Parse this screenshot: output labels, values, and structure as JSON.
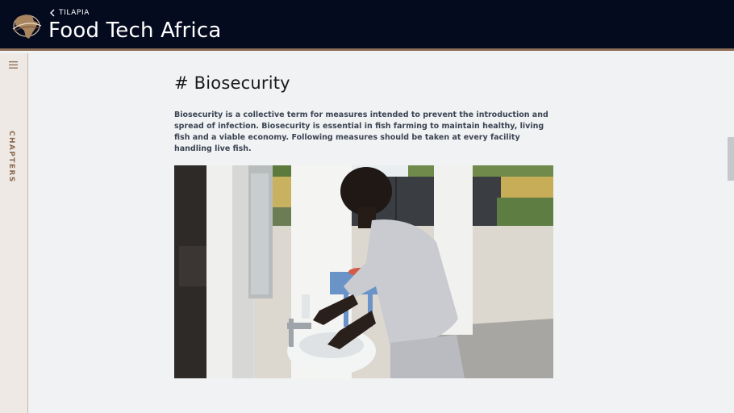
{
  "header": {
    "back_label": "TILAPIA",
    "title": "Food Tech Africa",
    "logo_icon": "africa-globe-logo-icon",
    "back_icon": "chevron-left-icon"
  },
  "sidebar": {
    "menu_icon": "hamburger-menu-icon",
    "chapters_label": "CHAPTERS"
  },
  "main": {
    "heading": "# Biosecurity",
    "paragraph": "Biosecurity is a collective term for measures intended to prevent the introduction and spread of infection. Biosecurity is essential in fish farming to maintain healthy, living fish and a viable economy. Following measures should be taken at every facility handling live fish."
  },
  "colors": {
    "header_bg": "#050b1f",
    "accent_brown": "#8b6d55",
    "sidebar_bg": "#eee9e4",
    "page_bg": "#f1f2f4"
  }
}
